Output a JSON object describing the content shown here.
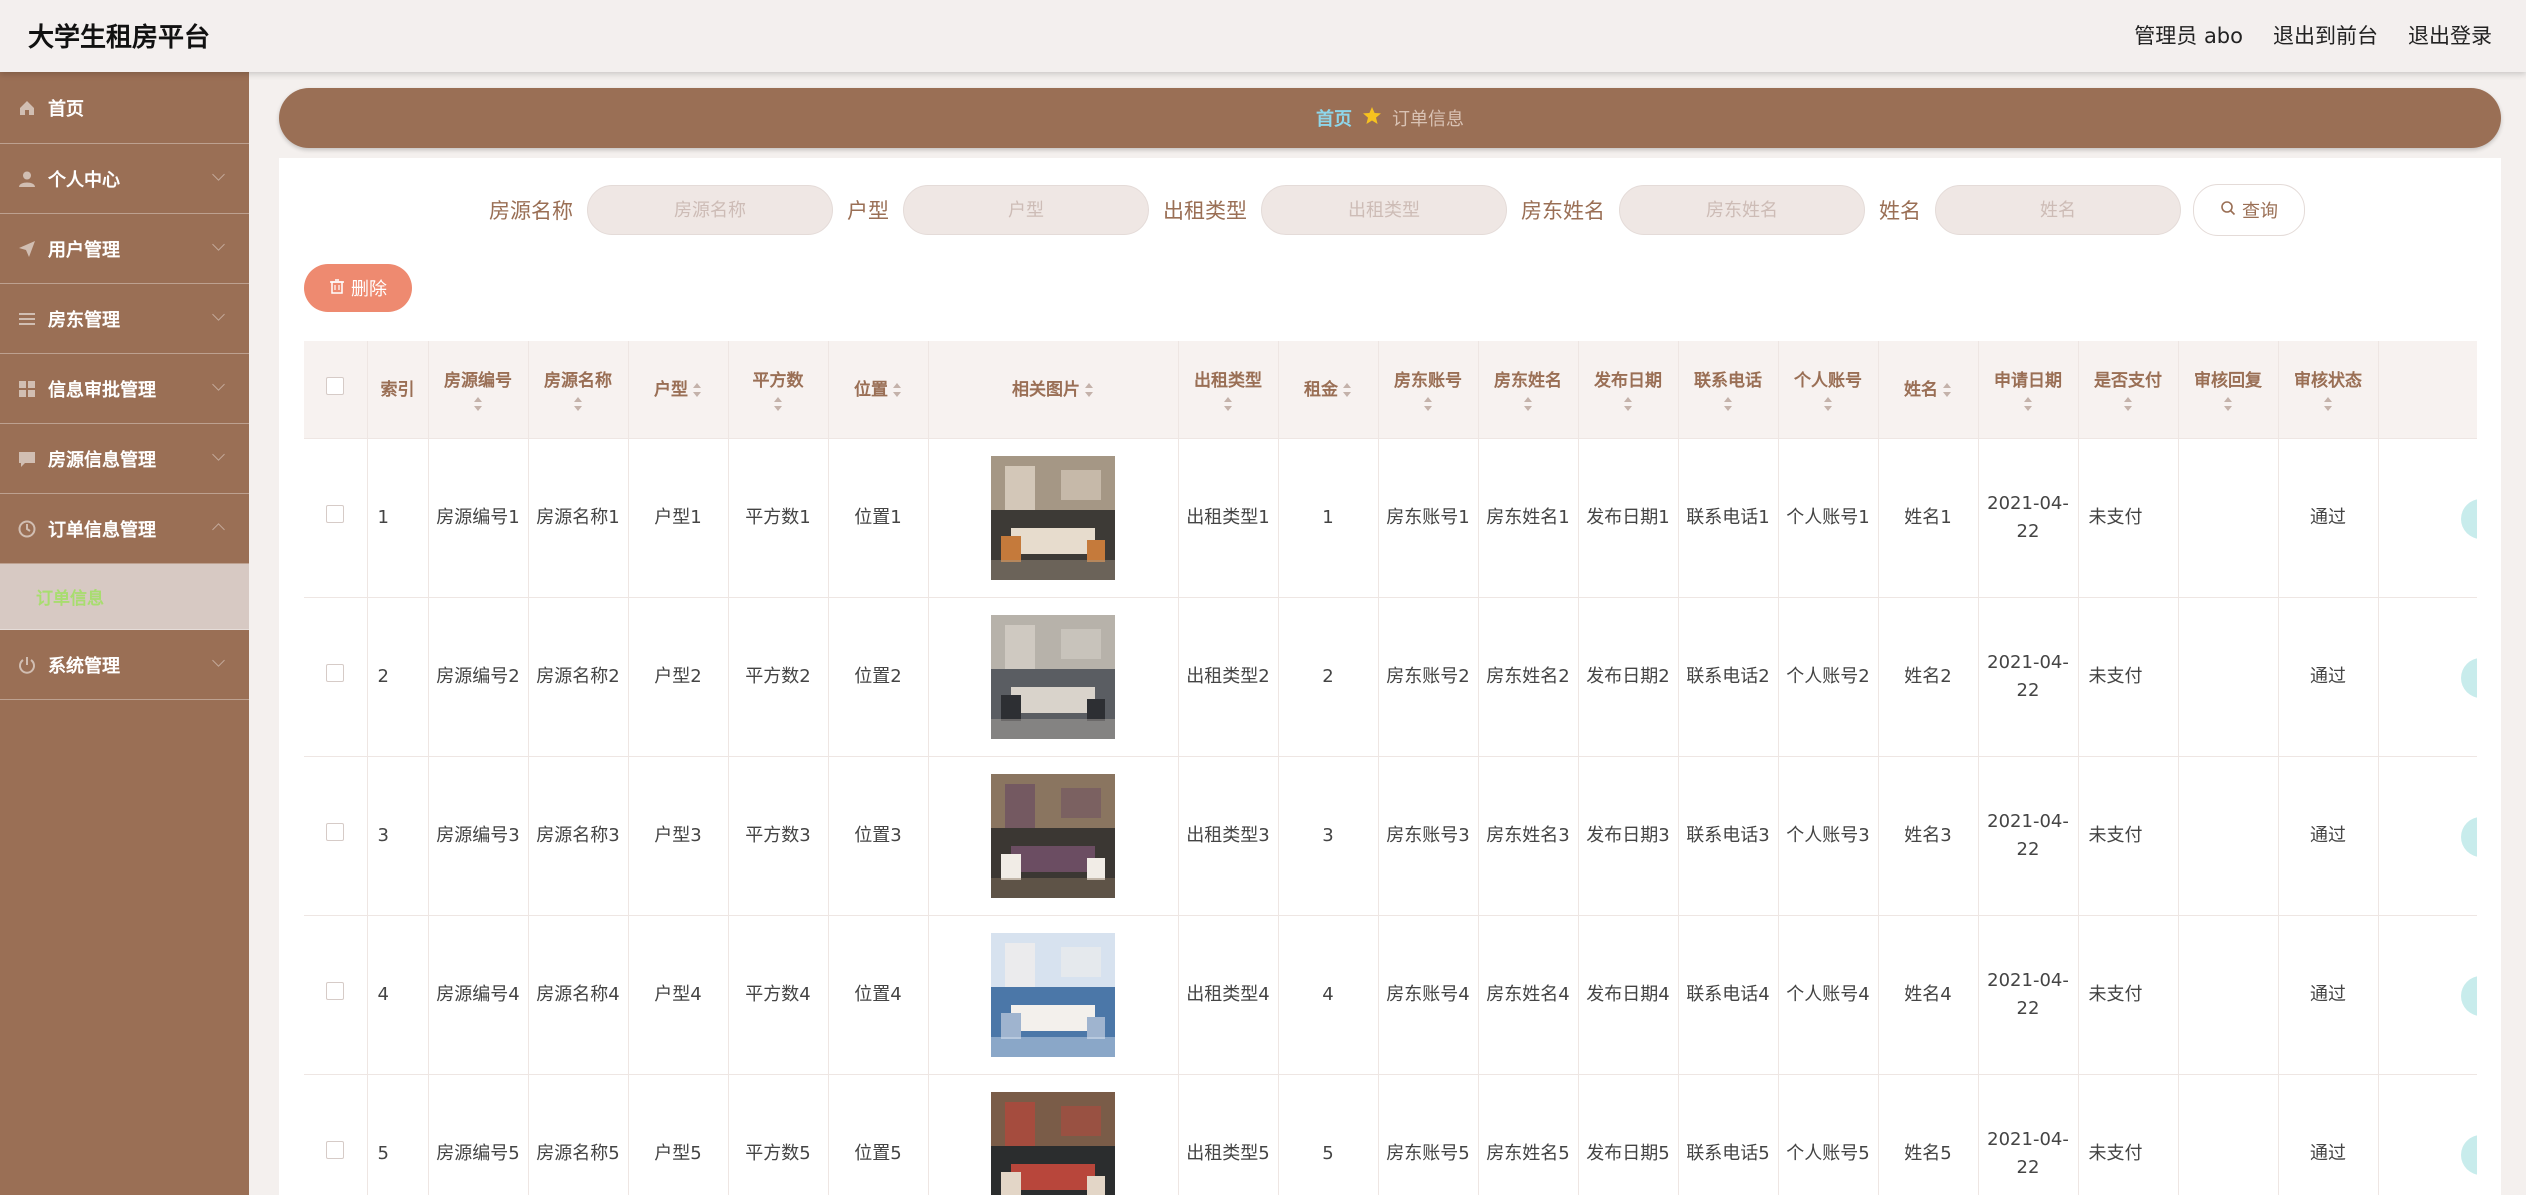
{
  "app": {
    "title": "大学生租房平台"
  },
  "top_actions": [
    "管理员 abo",
    "退出到前台",
    "退出登录"
  ],
  "sidebar": {
    "items": [
      {
        "label": "首页",
        "icon": "home-icon"
      },
      {
        "label": "个人中心",
        "icon": "user-icon"
      },
      {
        "label": "用户管理",
        "icon": "send-icon"
      },
      {
        "label": "房东管理",
        "icon": "list-icon"
      },
      {
        "label": "信息审批管理",
        "icon": "grid-icon"
      },
      {
        "label": "房源信息管理",
        "icon": "chat-icon"
      },
      {
        "label": "订单信息管理",
        "icon": "clock-icon"
      },
      {
        "label": "系统管理",
        "icon": "power-icon"
      }
    ],
    "submenu_active": "订单信息"
  },
  "breadcrumb": {
    "home": "首页",
    "current": "订单信息"
  },
  "search": {
    "fields": [
      {
        "label": "房源名称",
        "placeholder": "房源名称"
      },
      {
        "label": "户型",
        "placeholder": "户型"
      },
      {
        "label": "出租类型",
        "placeholder": "出租类型"
      },
      {
        "label": "房东姓名",
        "placeholder": "房东姓名"
      },
      {
        "label": "姓名",
        "placeholder": "姓名"
      }
    ],
    "button": "查询"
  },
  "toolbar": {
    "delete_label": "删除"
  },
  "table": {
    "columns": [
      "索引",
      "房源编号",
      "房源名称",
      "户型",
      "平方数",
      "位置",
      "相关图片",
      "出租类型",
      "租金",
      "房东账号",
      "房东姓名",
      "发布日期",
      "联系电话",
      "个人账号",
      "姓名",
      "申请日期",
      "是否支付",
      "审核回复",
      "审核状态"
    ],
    "rows": [
      {
        "index": "1",
        "house_no": "房源编号1",
        "house_name": "房源名称1",
        "layout": "户型1",
        "area": "平方数1",
        "location": "位置1",
        "rent_type": "出租类型1",
        "rent": "1",
        "landlord_account": "房东账号1",
        "landlord_name": "房东姓名1",
        "publish_date": "发布日期1",
        "phone": "联系电话1",
        "personal_account": "个人账号1",
        "name": "姓名1",
        "apply_date": "2021-04-22",
        "paid": "未支付",
        "reply": "",
        "status": "通过"
      },
      {
        "index": "2",
        "house_no": "房源编号2",
        "house_name": "房源名称2",
        "layout": "户型2",
        "area": "平方数2",
        "location": "位置2",
        "rent_type": "出租类型2",
        "rent": "2",
        "landlord_account": "房东账号2",
        "landlord_name": "房东姓名2",
        "publish_date": "发布日期2",
        "phone": "联系电话2",
        "personal_account": "个人账号2",
        "name": "姓名2",
        "apply_date": "2021-04-22",
        "paid": "未支付",
        "reply": "",
        "status": "通过"
      },
      {
        "index": "3",
        "house_no": "房源编号3",
        "house_name": "房源名称3",
        "layout": "户型3",
        "area": "平方数3",
        "location": "位置3",
        "rent_type": "出租类型3",
        "rent": "3",
        "landlord_account": "房东账号3",
        "landlord_name": "房东姓名3",
        "publish_date": "发布日期3",
        "phone": "联系电话3",
        "personal_account": "个人账号3",
        "name": "姓名3",
        "apply_date": "2021-04-22",
        "paid": "未支付",
        "reply": "",
        "status": "通过"
      },
      {
        "index": "4",
        "house_no": "房源编号4",
        "house_name": "房源名称4",
        "layout": "户型4",
        "area": "平方数4",
        "location": "位置4",
        "rent_type": "出租类型4",
        "rent": "4",
        "landlord_account": "房东账号4",
        "landlord_name": "房东姓名4",
        "publish_date": "发布日期4",
        "phone": "联系电话4",
        "personal_account": "个人账号4",
        "name": "姓名4",
        "apply_date": "2021-04-22",
        "paid": "未支付",
        "reply": "",
        "status": "通过"
      },
      {
        "index": "5",
        "house_no": "房源编号5",
        "house_name": "房源名称5",
        "layout": "户型5",
        "area": "平方数5",
        "location": "位置5",
        "rent_type": "出租类型5",
        "rent": "5",
        "landlord_account": "房东账号5",
        "landlord_name": "房东姓名5",
        "publish_date": "发布日期5",
        "phone": "联系电话5",
        "personal_account": "个人账号5",
        "name": "姓名5",
        "apply_date": "2021-04-22",
        "paid": "未支付",
        "reply": "",
        "status": "通过"
      }
    ]
  },
  "colors": {
    "brand": "#9a6f55",
    "danger_button": "#ee8a70",
    "breadcrumb_home": "#8ed6ea",
    "active_submenu_text": "#a8dd6f"
  }
}
